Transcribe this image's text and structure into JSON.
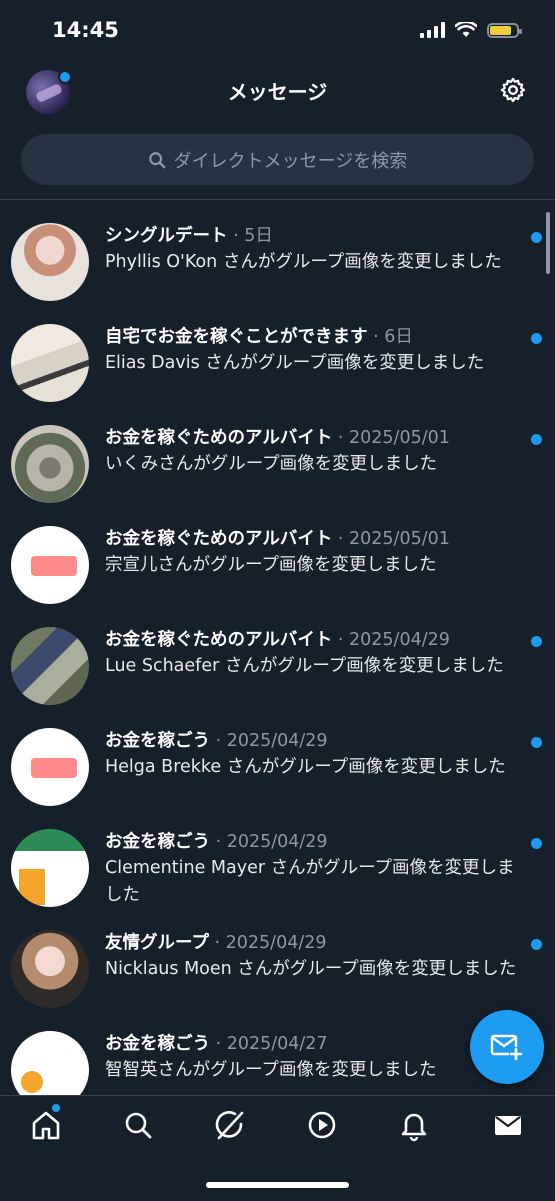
{
  "status": {
    "time": "14:45"
  },
  "header": {
    "title": "メッセージ"
  },
  "search": {
    "placeholder": "ダイレクトメッセージを検索"
  },
  "conversations": [
    {
      "name": "シングルデート",
      "date": " · 5日",
      "message": "Phyllis O'Kon さんがグループ画像を変更しました",
      "unread": true
    },
    {
      "name": "自宅でお金を稼ぐことができます",
      "date": " · 6日",
      "message": "Elias Davis さんがグループ画像を変更しました",
      "unread": true
    },
    {
      "name": "お金を稼ぐためのアルバイト",
      "date": " · 2025/05/01",
      "message": "いくみさんがグループ画像を変更しました",
      "unread": true
    },
    {
      "name": "お金を稼ぐためのアルバイト",
      "date": " · 2025/05/01",
      "message": "宗宣儿さんがグループ画像を変更しました",
      "unread": false
    },
    {
      "name": "お金を稼ぐためのアルバイト",
      "date": " · 2025/04/29",
      "message": "Lue Schaefer さんがグループ画像を変更しました",
      "unread": true
    },
    {
      "name": "お金を稼ごう",
      "date": " · 2025/04/29",
      "message": "Helga Brekke さんがグループ画像を変更しました",
      "unread": true
    },
    {
      "name": "お金を稼ごう",
      "date": " · 2025/04/29",
      "message": "Clementine Mayer さんがグループ画像を変更しました",
      "unread": true
    },
    {
      "name": "友情グループ",
      "date": " · 2025/04/29",
      "message": "Nicklaus Moen さんがグループ画像を変更しました",
      "unread": true
    },
    {
      "name": "お金を稼ごう",
      "date": " · 2025/04/27",
      "message": "智智英さんがグループ画像を変更しました",
      "unread": false
    }
  ],
  "icons": {
    "tabs": [
      "home-icon",
      "search-icon",
      "grok-icon",
      "play-icon",
      "bell-icon",
      "mail-icon"
    ],
    "fab": "new-message-icon"
  },
  "colors": {
    "background": "#15202b",
    "accent": "#1d9bf0",
    "muted": "#8b98a5"
  }
}
